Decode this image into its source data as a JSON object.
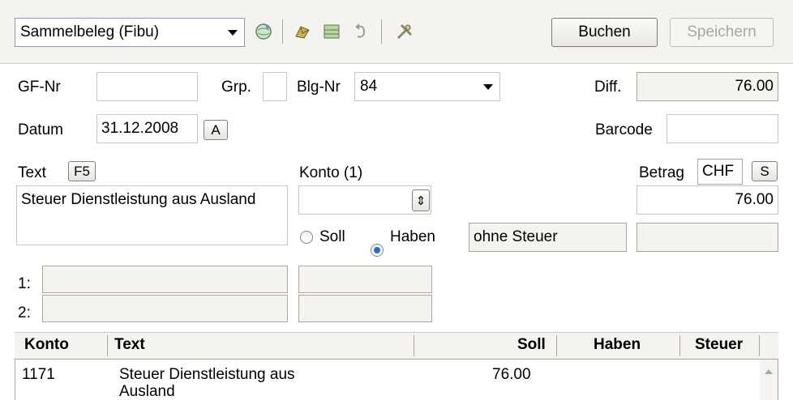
{
  "toolbar": {
    "doc_type_value": "Sammelbeleg (Fibu)",
    "post_label": "Buchen",
    "save_label": "Speichern"
  },
  "header": {
    "gf_nr_label": "GF-Nr",
    "gf_nr_value": "",
    "grp_label": "Grp.",
    "grp_value": "",
    "blg_nr_label": "Blg-Nr",
    "blg_nr_value": "84",
    "diff_label": "Diff.",
    "diff_value": "76.00",
    "datum_label": "Datum",
    "datum_value": "31.12.2008",
    "datum_key": "A",
    "barcode_label": "Barcode",
    "barcode_value": ""
  },
  "entry": {
    "text_label": "Text",
    "text_key": "F5",
    "text_value": "Steuer Dienstleistung aus Ausland",
    "konto_label": "Konto (1)",
    "konto_value": "",
    "soll_label": "Soll",
    "haben_label": "Haben",
    "selected_side": "Haben",
    "tax_value": "ohne Steuer",
    "betrag_label": "Betrag",
    "currency_value": "CHF",
    "currency_key": "S",
    "amount_value": "76.00",
    "line1_label": "1:",
    "line2_label": "2:"
  },
  "grid": {
    "columns": [
      "Konto",
      "Text",
      "Soll",
      "Haben",
      "Steuer"
    ],
    "rows": [
      {
        "konto": "1171",
        "text": "Steuer Dienstleistung aus Ausland",
        "soll": "76.00",
        "haben": "",
        "steuer": ""
      }
    ]
  },
  "colors": {
    "accent": "#2a6bd1",
    "panel": "#f4f3ef"
  }
}
